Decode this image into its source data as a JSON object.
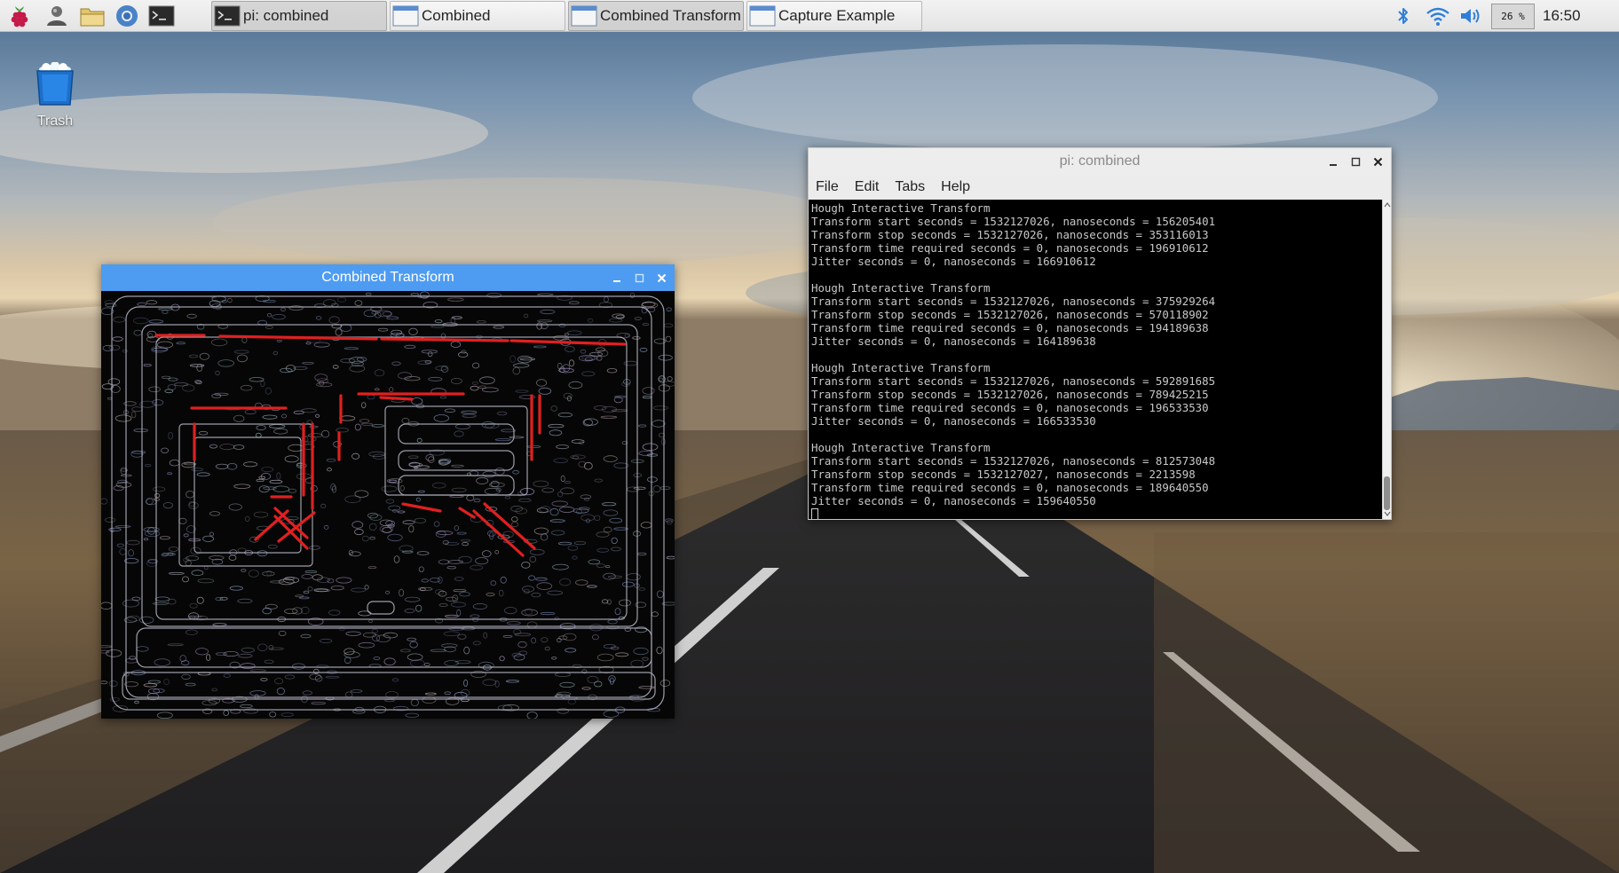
{
  "taskbar": {
    "launchers": [
      {
        "icon": "raspberry-menu-icon"
      },
      {
        "icon": "pi-user-icon"
      },
      {
        "icon": "file-manager-icon"
      },
      {
        "icon": "chromium-icon"
      },
      {
        "icon": "terminal-icon"
      }
    ],
    "tasks": [
      {
        "label": "pi: combined",
        "icon": "terminal-icon",
        "active": true
      },
      {
        "label": "Combined",
        "icon": "window-icon",
        "active": false
      },
      {
        "label": "Combined Transform",
        "icon": "window-icon",
        "active": true
      },
      {
        "label": "Capture Example",
        "icon": "window-icon",
        "active": false
      }
    ],
    "tray": {
      "bluetooth_icon": "bluetooth-icon",
      "wifi_icon": "wifi-icon",
      "volume_icon": "volume-icon",
      "cpu_usage": "26 %",
      "clock": "16:50"
    }
  },
  "desktop": {
    "trash_label": "Trash"
  },
  "transform_window": {
    "title": "Combined Transform"
  },
  "terminal_window": {
    "title": "pi: combined",
    "menu": [
      "File",
      "Edit",
      "Tabs",
      "Help"
    ],
    "lines": [
      "Hough Interactive Transform",
      "Transform start seconds = 1532127026, nanoseconds = 156205401",
      "Transform stop seconds = 1532127026, nanoseconds = 353116013",
      "Transform time required seconds = 0, nanoseconds = 196910612",
      "Jitter seconds = 0, nanoseconds = 166910612",
      "",
      "Hough Interactive Transform",
      "Transform start seconds = 1532127026, nanoseconds = 375929264",
      "Transform stop seconds = 1532127026, nanoseconds = 570118902",
      "Transform time required seconds = 0, nanoseconds = 194189638",
      "Jitter seconds = 0, nanoseconds = 164189638",
      "",
      "Hough Interactive Transform",
      "Transform start seconds = 1532127026, nanoseconds = 592891685",
      "Transform stop seconds = 1532127026, nanoseconds = 789425215",
      "Transform time required seconds = 0, nanoseconds = 196533530",
      "Jitter seconds = 0, nanoseconds = 166533530",
      "",
      "Hough Interactive Transform",
      "Transform start seconds = 1532127026, nanoseconds = 812573048",
      "Transform stop seconds = 1532127027, nanoseconds = 2213598",
      "Transform time required seconds = 0, nanoseconds = 189640550",
      "Jitter seconds = 0, nanoseconds = 159640550"
    ]
  },
  "colors": {
    "panel_bg": "#e9e9e9",
    "titlebar_active": "#4d9cf2",
    "terminal_bg": "#000000",
    "terminal_fg": "#c8c8c8",
    "hough_line": "#e02020"
  }
}
